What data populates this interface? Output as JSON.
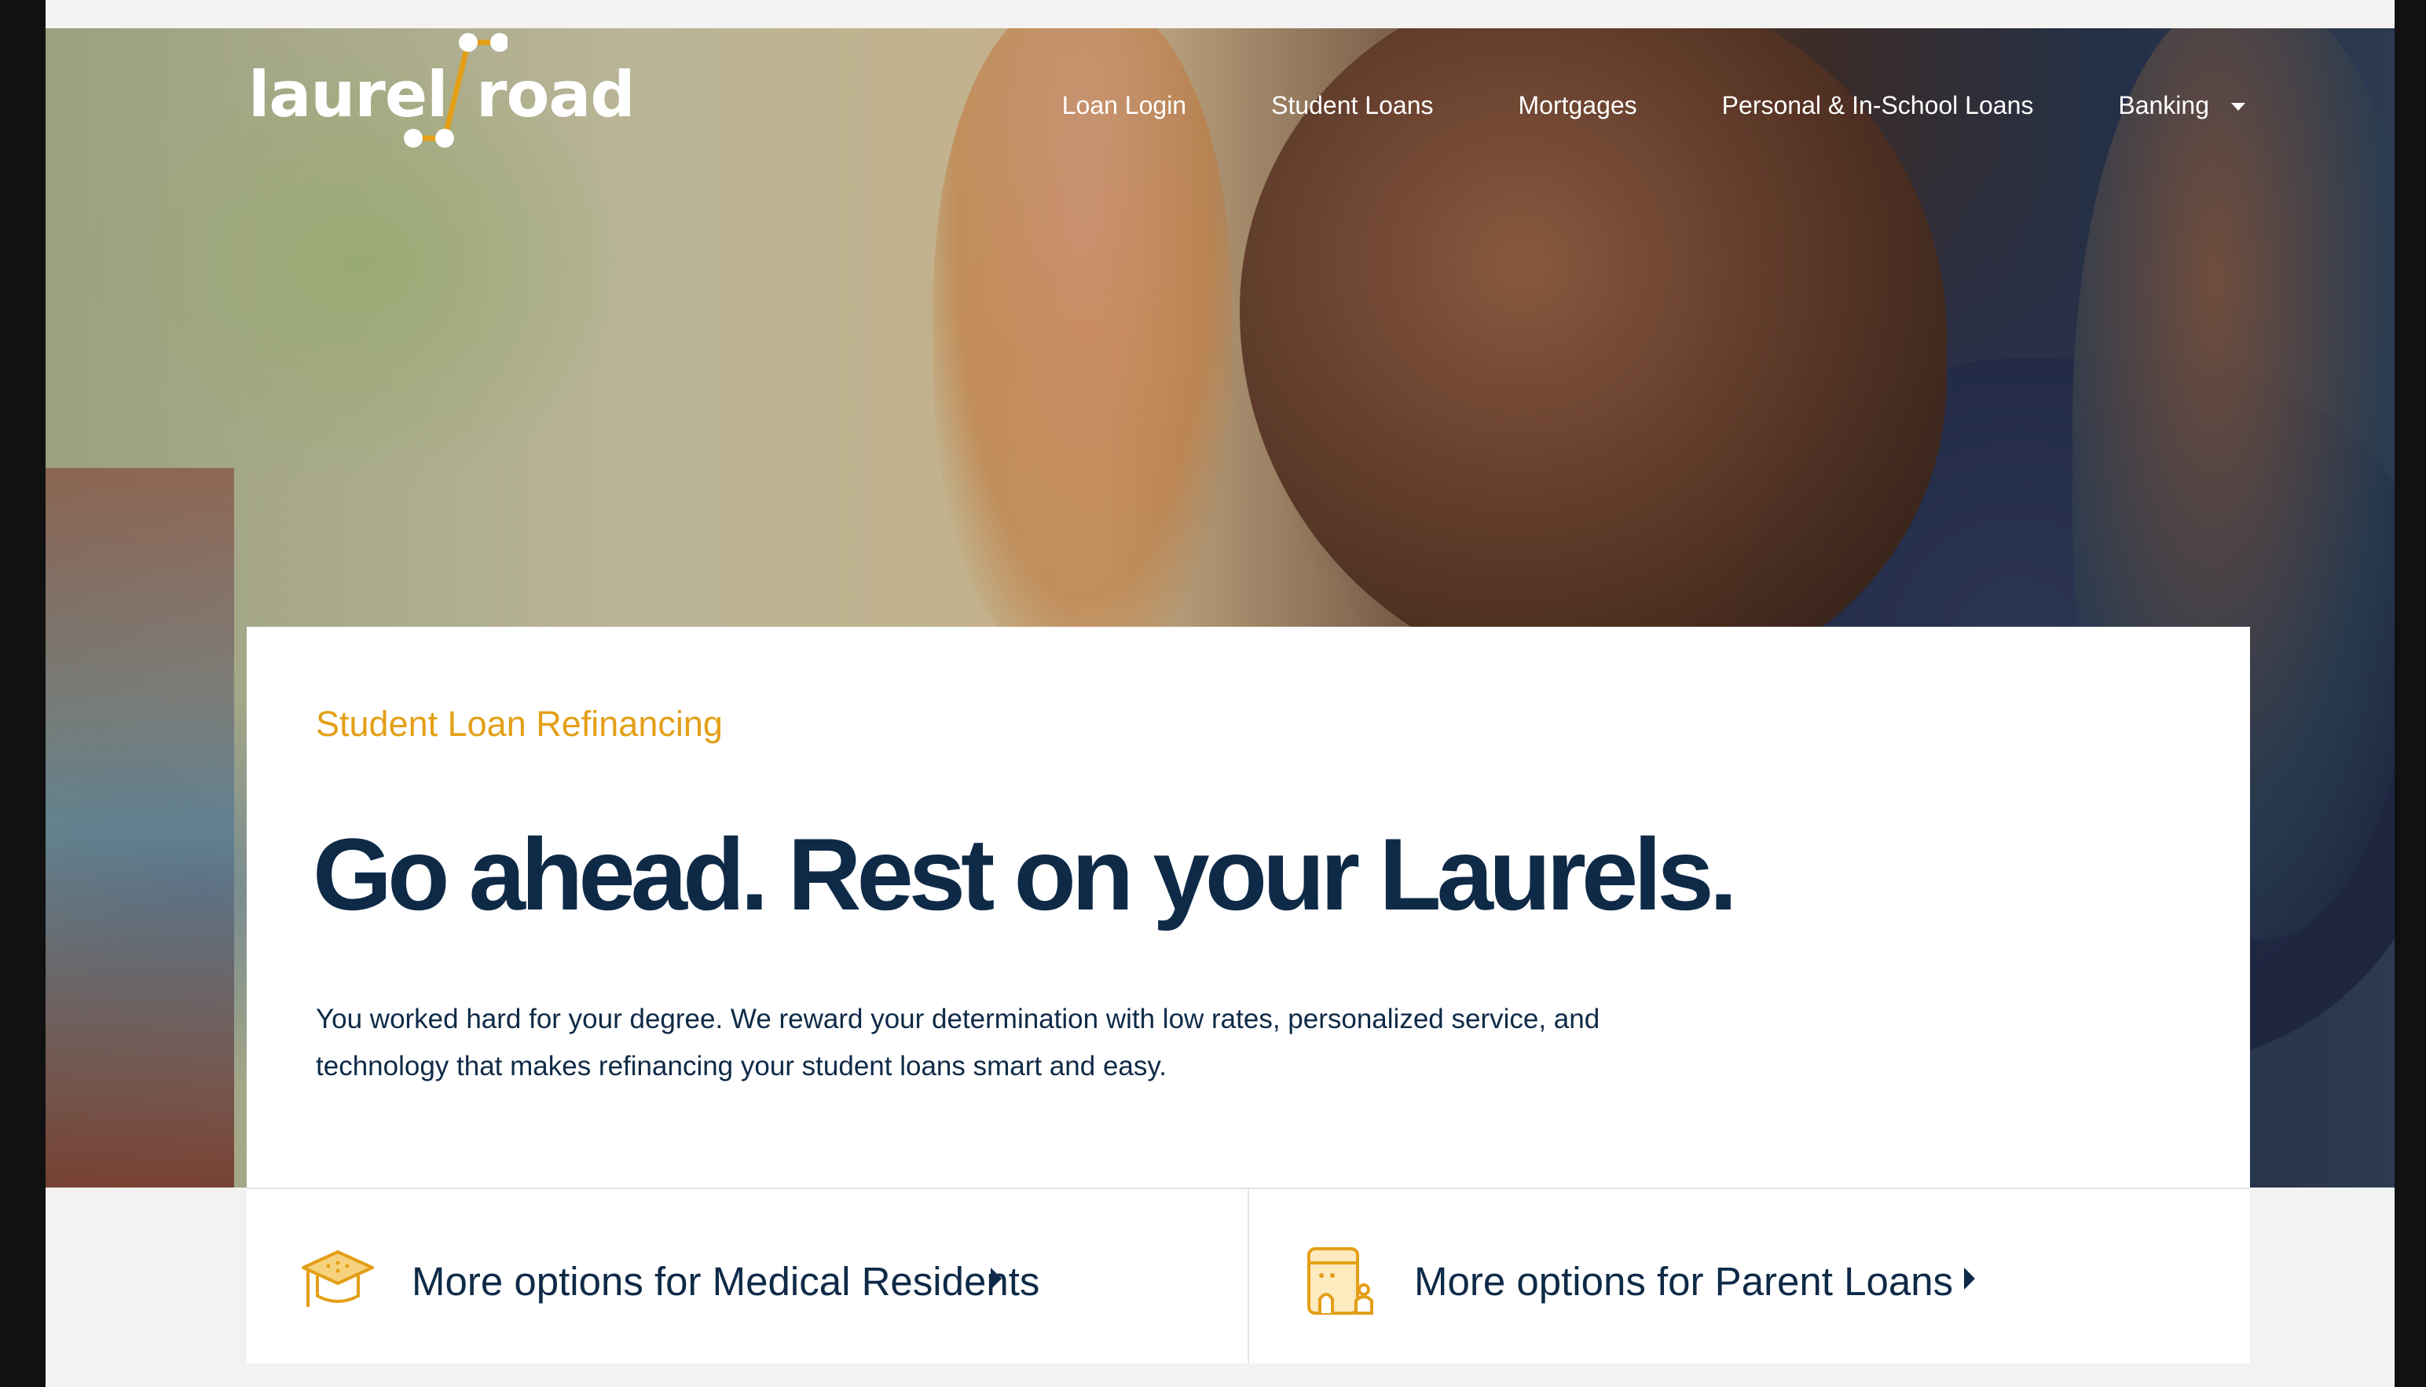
{
  "brand": {
    "logo_left": "laurel",
    "logo_right": "road",
    "accent_color": "#e39f17",
    "navy_color": "#0e2a47"
  },
  "nav": {
    "items": [
      {
        "label": "Loan Login"
      },
      {
        "label": "Student Loans"
      },
      {
        "label": "Mortgages"
      },
      {
        "label": "Personal & In-School Loans"
      },
      {
        "label": "Banking",
        "has_dropdown": true
      }
    ]
  },
  "hero": {
    "eyebrow": "Student Loan Refinancing",
    "headline": "Go ahead. Rest on your Laurels.",
    "body_line1": "You worked hard for your degree. We reward your determination with low rates, personalized service, and",
    "body_line2": "technology that makes refinancing your student loans smart and easy."
  },
  "options": [
    {
      "label": "More options for Medical Residents",
      "icon": "graduation-cap-icon"
    },
    {
      "label": "More options for Parent Loans",
      "icon": "family-calculator-icon"
    }
  ]
}
